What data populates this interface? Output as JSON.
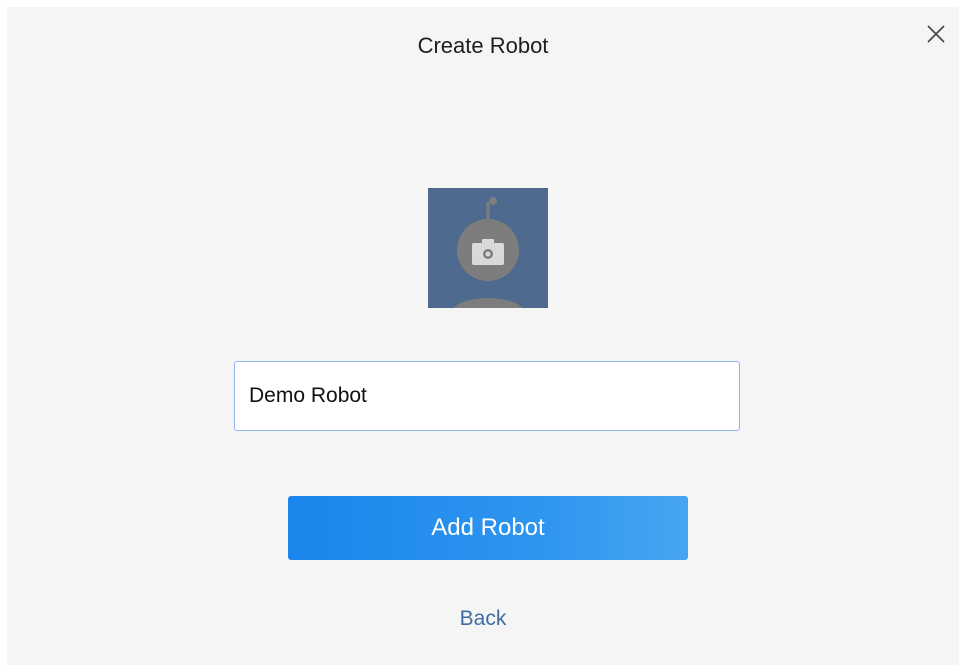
{
  "dialog": {
    "title": "Create Robot",
    "close_icon": "close-icon"
  },
  "avatar": {
    "icon": "robot-avatar-camera-icon",
    "background_color": "#4e6a8e"
  },
  "name_input": {
    "value": "Demo Robot",
    "placeholder": ""
  },
  "buttons": {
    "add_robot_label": "Add Robot",
    "back_label": "Back"
  },
  "colors": {
    "accent": "#2f8ff0",
    "link": "#3f6da3",
    "background": "#f5f5f5"
  }
}
